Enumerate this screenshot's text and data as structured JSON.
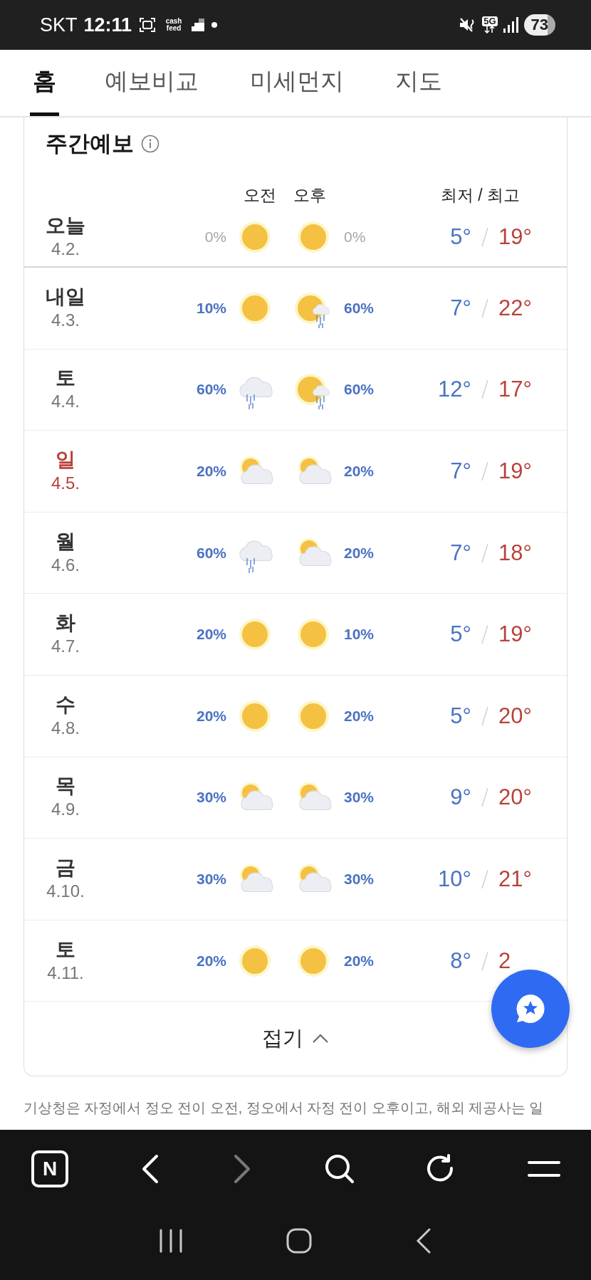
{
  "status_bar": {
    "carrier": "SKT",
    "time": "12:11",
    "app_label": "cash feed",
    "network": "5G",
    "battery": "73"
  },
  "tabs": [
    {
      "label": "홈",
      "selected": true
    },
    {
      "label": "예보비교",
      "selected": false
    },
    {
      "label": "미세먼지",
      "selected": false
    },
    {
      "label": "지도",
      "selected": false
    }
  ],
  "forecast": {
    "title": "주간예보",
    "am_header": "오전",
    "pm_header": "오후",
    "temp_header": "최저 / 최고",
    "rows": [
      {
        "day": "오늘",
        "date": "4.2.",
        "today": true,
        "holiday": false,
        "am": {
          "kind": "sun",
          "pop": "0%"
        },
        "pm": {
          "kind": "sun",
          "pop": "0%"
        },
        "min": "5°",
        "max": "19°"
      },
      {
        "day": "내일",
        "date": "4.3.",
        "today": false,
        "holiday": false,
        "am": {
          "kind": "sun",
          "pop": "10%"
        },
        "pm": {
          "kind": "sun-rain",
          "pop": "60%"
        },
        "min": "7°",
        "max": "22°"
      },
      {
        "day": "토",
        "date": "4.4.",
        "today": false,
        "holiday": false,
        "am": {
          "kind": "rain",
          "pop": "60%"
        },
        "pm": {
          "kind": "sun-rain",
          "pop": "60%"
        },
        "min": "12°",
        "max": "17°"
      },
      {
        "day": "일",
        "date": "4.5.",
        "today": false,
        "holiday": true,
        "am": {
          "kind": "partly",
          "pop": "20%"
        },
        "pm": {
          "kind": "partly",
          "pop": "20%"
        },
        "min": "7°",
        "max": "19°"
      },
      {
        "day": "월",
        "date": "4.6.",
        "today": false,
        "holiday": false,
        "am": {
          "kind": "rain",
          "pop": "60%"
        },
        "pm": {
          "kind": "partly",
          "pop": "20%"
        },
        "min": "7°",
        "max": "18°"
      },
      {
        "day": "화",
        "date": "4.7.",
        "today": false,
        "holiday": false,
        "am": {
          "kind": "sun",
          "pop": "20%"
        },
        "pm": {
          "kind": "sun",
          "pop": "10%"
        },
        "min": "5°",
        "max": "19°"
      },
      {
        "day": "수",
        "date": "4.8.",
        "today": false,
        "holiday": false,
        "am": {
          "kind": "sun",
          "pop": "20%"
        },
        "pm": {
          "kind": "sun",
          "pop": "20%"
        },
        "min": "5°",
        "max": "20°"
      },
      {
        "day": "목",
        "date": "4.9.",
        "today": false,
        "holiday": false,
        "am": {
          "kind": "partly",
          "pop": "30%"
        },
        "pm": {
          "kind": "partly",
          "pop": "30%"
        },
        "min": "9°",
        "max": "20°"
      },
      {
        "day": "금",
        "date": "4.10.",
        "today": false,
        "holiday": false,
        "am": {
          "kind": "partly",
          "pop": "30%"
        },
        "pm": {
          "kind": "partly",
          "pop": "30%"
        },
        "min": "10°",
        "max": "21°"
      },
      {
        "day": "토",
        "date": "4.11.",
        "today": false,
        "holiday": false,
        "am": {
          "kind": "sun",
          "pop": "20%"
        },
        "pm": {
          "kind": "sun",
          "pop": "20%"
        },
        "min": "8°",
        "max": "2"
      }
    ],
    "collapse": "접기"
  },
  "note": "기상청은 자정에서 정오 전이 오전, 정오에서 자정 전이 오후이고, 해외 제공사는 일",
  "toolbar": {
    "logo": "N"
  }
}
